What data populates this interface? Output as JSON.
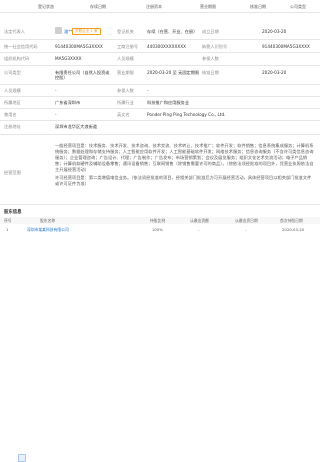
{
  "header": {
    "col1": "登记状态",
    "col2": "存续日期",
    "col3": "注册资本",
    "col4": "营业期限",
    "col5": "核准日期",
    "col6": "公司类型"
  },
  "rows": [
    {
      "l1": "法定代表人",
      "v1": "",
      "l2": "登记机关",
      "v2": "存续（在营、开业、在册）",
      "l3": "成立日期",
      "v3": "2020-03-20"
    },
    {
      "l1": "统一社会信用代码",
      "v1": "91440300MA5G3XXXX",
      "l2": "工商注册号",
      "v2": "440300XXXXXXXX",
      "l3": "纳税人识别号",
      "v3": "91440300MA5G3XXXX"
    },
    {
      "l1": "组织机构代码",
      "v1": "MA5G3XXXX",
      "l2": "人员规模",
      "v2": "",
      "l3": "参保人数",
      "v3": ""
    },
    {
      "l1": "公司类型",
      "v1": "有限责任公司（自然人投资或控股）",
      "l2": "营业期限",
      "v2": "2020-03-20 至 无固定期限",
      "l3": "核准日期",
      "v3": "2020-03-20"
    },
    {
      "l1": "人员规模",
      "v1": "-",
      "l2": "参保人数",
      "v2": "-",
      "l3": "",
      "v3": ""
    },
    {
      "l1": "所属地区",
      "v1": "广东省深圳市",
      "l2": "所属行业",
      "v2": "科技推广和应用服务业",
      "l3": "",
      "v3": ""
    },
    {
      "l1": "曾用名",
      "v1": "-",
      "l2": "英文名",
      "v2": "Ponder Ping Ping Technology Co., Ltd.",
      "l3": "",
      "v3": ""
    },
    {
      "l1": "注册地址",
      "v1": "深圳市龙华区大浪街道",
      "l2": "",
      "v2": "",
      "l3": "",
      "v3": ""
    }
  ],
  "legal_rep": {
    "name": "潘**",
    "tag": "关联企业 1 家"
  },
  "scope_label": "经营范围",
  "scope_paragraphs": [
    "一般经营项目是：技术服务、技术开发、技术咨询、技术交流、技术转让、技术推广；软件开发；软件销售；信息系统集成服务；计算机系统服务；数据处理和存储支持服务；人工智能应用软件开发；人工智能基础软件开发；网络技术服务；信息咨询服务（不含许可类信息咨询服务）；企业管理咨询；广告设计、代理；广告制作；广告发布；市场营销策划；会议及展览服务；组织文化艺术交流活动；电子产品销售；计算机软硬件及辅助设备零售；通讯设备销售；互联网销售（除销售需要许可的商品）。（除依法须经批准的项目外，凭营业执照依法自主开展经营活动）",
    "许可经营项目是：第二类增值电信业务。（依法须经批准的项目，经相关部门批准后方可开展经营活动，具体经营项目以相关部门批准文件或许可证件为准）"
  ],
  "section_title": "股东信息",
  "table_headers": [
    "序号",
    "股东名称",
    "持股比例",
    "认缴出资额",
    "认缴出资日期",
    "首次持股日期"
  ],
  "table_rows": [
    {
      "idx": "1",
      "name": "深圳市某某科技有限公司",
      "ratio": "100%",
      "amount": "-",
      "date": "-",
      "first": "2020-03-20"
    }
  ]
}
